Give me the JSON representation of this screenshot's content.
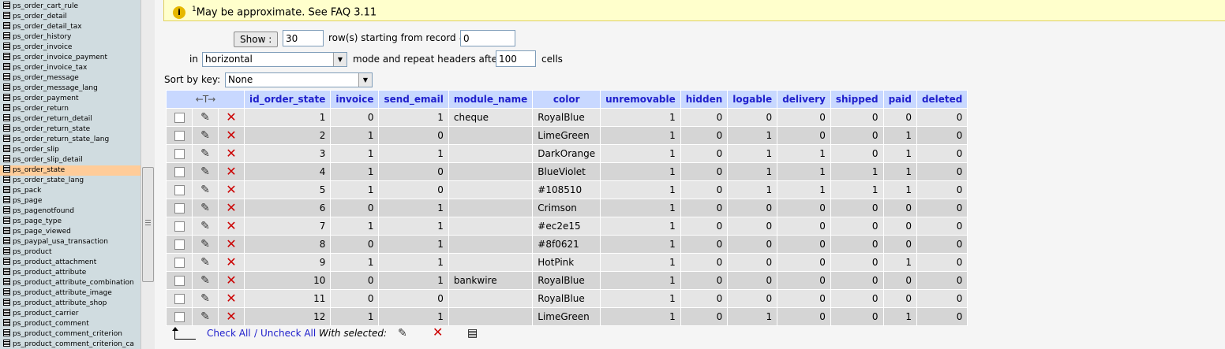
{
  "sidebar": {
    "items": [
      {
        "label": "ps_order_cart_rule",
        "active": false
      },
      {
        "label": "ps_order_detail",
        "active": false
      },
      {
        "label": "ps_order_detail_tax",
        "active": false
      },
      {
        "label": "ps_order_history",
        "active": false
      },
      {
        "label": "ps_order_invoice",
        "active": false
      },
      {
        "label": "ps_order_invoice_payment",
        "active": false
      },
      {
        "label": "ps_order_invoice_tax",
        "active": false
      },
      {
        "label": "ps_order_message",
        "active": false
      },
      {
        "label": "ps_order_message_lang",
        "active": false
      },
      {
        "label": "ps_order_payment",
        "active": false
      },
      {
        "label": "ps_order_return",
        "active": false
      },
      {
        "label": "ps_order_return_detail",
        "active": false
      },
      {
        "label": "ps_order_return_state",
        "active": false
      },
      {
        "label": "ps_order_return_state_lang",
        "active": false
      },
      {
        "label": "ps_order_slip",
        "active": false
      },
      {
        "label": "ps_order_slip_detail",
        "active": false
      },
      {
        "label": "ps_order_state",
        "active": true
      },
      {
        "label": "ps_order_state_lang",
        "active": false
      },
      {
        "label": "ps_pack",
        "active": false
      },
      {
        "label": "ps_page",
        "active": false
      },
      {
        "label": "ps_pagenotfound",
        "active": false
      },
      {
        "label": "ps_page_type",
        "active": false
      },
      {
        "label": "ps_page_viewed",
        "active": false
      },
      {
        "label": "ps_paypal_usa_transaction",
        "active": false
      },
      {
        "label": "ps_product",
        "active": false
      },
      {
        "label": "ps_product_attachment",
        "active": false
      },
      {
        "label": "ps_product_attribute",
        "active": false
      },
      {
        "label": "ps_product_attribute_combination",
        "active": false
      },
      {
        "label": "ps_product_attribute_image",
        "active": false
      },
      {
        "label": "ps_product_attribute_shop",
        "active": false
      },
      {
        "label": "ps_product_carrier",
        "active": false
      },
      {
        "label": "ps_product_comment",
        "active": false
      },
      {
        "label": "ps_product_comment_criterion",
        "active": false
      },
      {
        "label": "ps_product_comment_criterion_ca",
        "active": false
      }
    ]
  },
  "notice": {
    "footnote_mark": "1",
    "text": "May be approximate. See FAQ 3.11"
  },
  "navigation": {
    "show_label": "Show :",
    "rows_value": "30",
    "rows_label": "row(s) starting from record #",
    "start_value": "0",
    "in_label": "in",
    "mode_value": "horizontal",
    "mode_label": "mode and repeat headers after",
    "repeat_value": "100",
    "cells_label": "cells",
    "sort_label": "Sort by key:",
    "sort_value": "None"
  },
  "table": {
    "columns": [
      "id_order_state",
      "invoice",
      "send_email",
      "module_name",
      "color",
      "unremovable",
      "hidden",
      "logable",
      "delivery",
      "shipped",
      "paid",
      "deleted"
    ],
    "rows": [
      [
        "1",
        "0",
        "1",
        "cheque",
        "RoyalBlue",
        "1",
        "0",
        "0",
        "0",
        "0",
        "0",
        "0"
      ],
      [
        "2",
        "1",
        "0",
        "",
        "LimeGreen",
        "1",
        "0",
        "1",
        "0",
        "0",
        "1",
        "0"
      ],
      [
        "3",
        "1",
        "1",
        "",
        "DarkOrange",
        "1",
        "0",
        "1",
        "1",
        "0",
        "1",
        "0"
      ],
      [
        "4",
        "1",
        "0",
        "",
        "BlueViolet",
        "1",
        "0",
        "1",
        "1",
        "1",
        "1",
        "0"
      ],
      [
        "5",
        "1",
        "0",
        "",
        "#108510",
        "1",
        "0",
        "1",
        "1",
        "1",
        "1",
        "0"
      ],
      [
        "6",
        "0",
        "1",
        "",
        "Crimson",
        "1",
        "0",
        "0",
        "0",
        "0",
        "0",
        "0"
      ],
      [
        "7",
        "1",
        "1",
        "",
        "#ec2e15",
        "1",
        "0",
        "0",
        "0",
        "0",
        "0",
        "0"
      ],
      [
        "8",
        "0",
        "1",
        "",
        "#8f0621",
        "1",
        "0",
        "0",
        "0",
        "0",
        "0",
        "0"
      ],
      [
        "9",
        "1",
        "1",
        "",
        "HotPink",
        "1",
        "0",
        "0",
        "0",
        "0",
        "1",
        "0"
      ],
      [
        "10",
        "0",
        "1",
        "bankwire",
        "RoyalBlue",
        "1",
        "0",
        "0",
        "0",
        "0",
        "0",
        "0"
      ],
      [
        "11",
        "0",
        "0",
        "",
        "RoyalBlue",
        "1",
        "0",
        "0",
        "0",
        "0",
        "0",
        "0"
      ],
      [
        "12",
        "1",
        "1",
        "",
        "LimeGreen",
        "1",
        "0",
        "1",
        "0",
        "0",
        "1",
        "0"
      ]
    ]
  },
  "footer": {
    "check_all": "Check All",
    "separator": "/",
    "uncheck_all": "Uncheck All",
    "with_selected": "With selected:"
  },
  "colors": {
    "header_bg": "#c8d8ff",
    "header_text": "#2020cc",
    "active_item": "#ffcc99",
    "notice_bg": "#ffffcc",
    "delete": "#cc0000"
  },
  "icons": {
    "edit": "pencil-icon",
    "delete": "delete-icon",
    "export": "export-icon",
    "info": "info-icon"
  }
}
